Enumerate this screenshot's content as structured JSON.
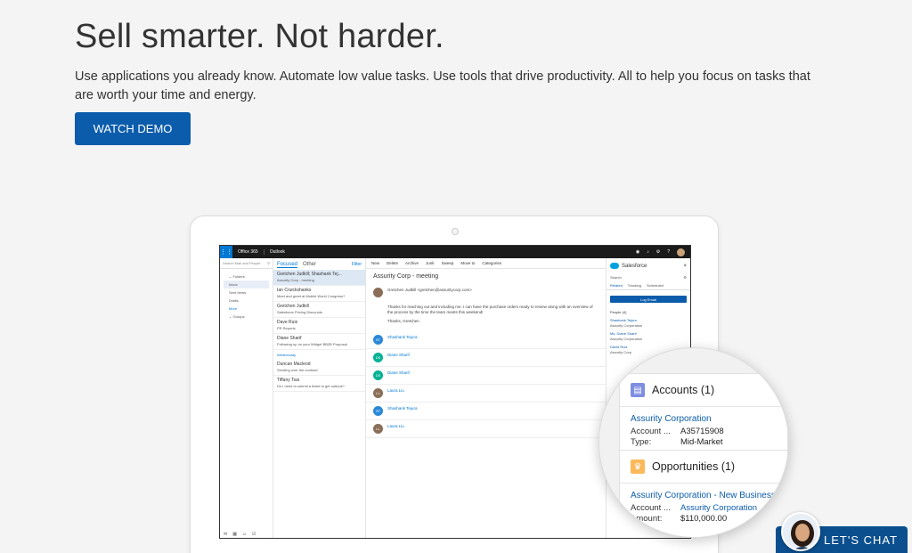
{
  "hero": {
    "title": "Sell smarter. Not harder.",
    "description": "Use applications you already know. Automate low value tasks. Use tools that drive productivity. All to help you focus on tasks that are worth your time and energy.",
    "cta_label": "WATCH DEMO"
  },
  "outlook": {
    "brand": "Office 365",
    "app": "Outlook",
    "search_placeholder": "Search Mail and People",
    "folders_label": "Folders",
    "folders": [
      "Inbox",
      "Sent Items",
      "Drafts",
      "More"
    ],
    "groups_label": "Groups",
    "tabs": {
      "focused": "Focused",
      "other": "Other",
      "filter": "Filter"
    },
    "mails": [
      {
        "from": "Gretchen Judkill; Shashank Tej...",
        "preview": "Assurity Corp - meeting"
      },
      {
        "from": "Ian Cruickshanks",
        "preview": "Meet and greet at Mobile World Congress?"
      },
      {
        "from": "Gretchen Judkill",
        "preview": "Salesforce Pricing Discounts"
      },
      {
        "from": "Dave Ruiz",
        "preview": "PR Reports"
      },
      {
        "from": "Diane Sharif",
        "preview": "Following up on your Widget BB2B Proposal"
      }
    ],
    "day_group": "Wednesday",
    "mails_2": [
      {
        "from": "Duncan Macleod",
        "preview": "Sending over the contract"
      },
      {
        "from": "Tiffany Tsai",
        "preview": "Do I need to submit a ticket to get outlook?"
      }
    ],
    "toolbar": [
      "New",
      "Delete",
      "Archive",
      "Junk",
      "Sweep",
      "Move to",
      "Categories"
    ],
    "subject": "Assurity Corp - meeting",
    "sender": "Gretchen Judkill <gretchen@assuritycorp.com>",
    "body": "Thanks for reaching out and including me. I can have the purchase orders ready to review along with an overview of the process by the time the team meets this weekend!",
    "signoff": "Thanks, Gretchen",
    "thread": [
      {
        "initials": "ST",
        "name": "Shashank Tejura",
        "color": "#2b88d8"
      },
      {
        "initials": "DS",
        "name": "Diane Sharif",
        "color": "#00b294"
      },
      {
        "initials": "DS",
        "name": "Diane Sharif",
        "color": "#00b294"
      },
      {
        "initials": "LL",
        "name": "Laura Liu",
        "color": "#8a6e58"
      },
      {
        "initials": "ST",
        "name": "Shashank Tejura",
        "color": "#2b88d8"
      },
      {
        "initials": "LL",
        "name": "Laura Liu",
        "color": "#8a6e58"
      }
    ]
  },
  "salesforce": {
    "name": "Salesforce",
    "search_placeholder": "Search",
    "tabs": [
      "Related",
      "Tracking",
      "Scheduled"
    ],
    "log_email": "Log Email",
    "people_label": "People (4)",
    "people": [
      {
        "name": "Shashank Tejura",
        "account": "Assurity Corporation"
      },
      {
        "name": "Ms. Diane Sharif",
        "account": "Assurity Corporation"
      },
      {
        "name": "David Ruiz",
        "account": "Assurity Corp"
      }
    ]
  },
  "zoom": {
    "accounts": {
      "title": "Accounts (1)",
      "link": "Assurity Corporation",
      "rows": [
        {
          "label": "Account ...",
          "value": "A35715908"
        },
        {
          "label": "Type:",
          "value": "Mid-Market"
        }
      ]
    },
    "opportunities": {
      "title": "Opportunities (1)",
      "link": "Assurity Corporation - New Business",
      "rows": [
        {
          "label": "Account ...",
          "value": "Assurity Corporation",
          "value_is_link": true
        },
        {
          "label": "Amount:",
          "value": "$110,000.00"
        }
      ]
    }
  },
  "chat": {
    "label": "LET'S CHAT"
  },
  "colors": {
    "brand_blue": "#0b5cab",
    "chat_blue": "#0b4f8e",
    "outlook_blue": "#0078d4"
  }
}
